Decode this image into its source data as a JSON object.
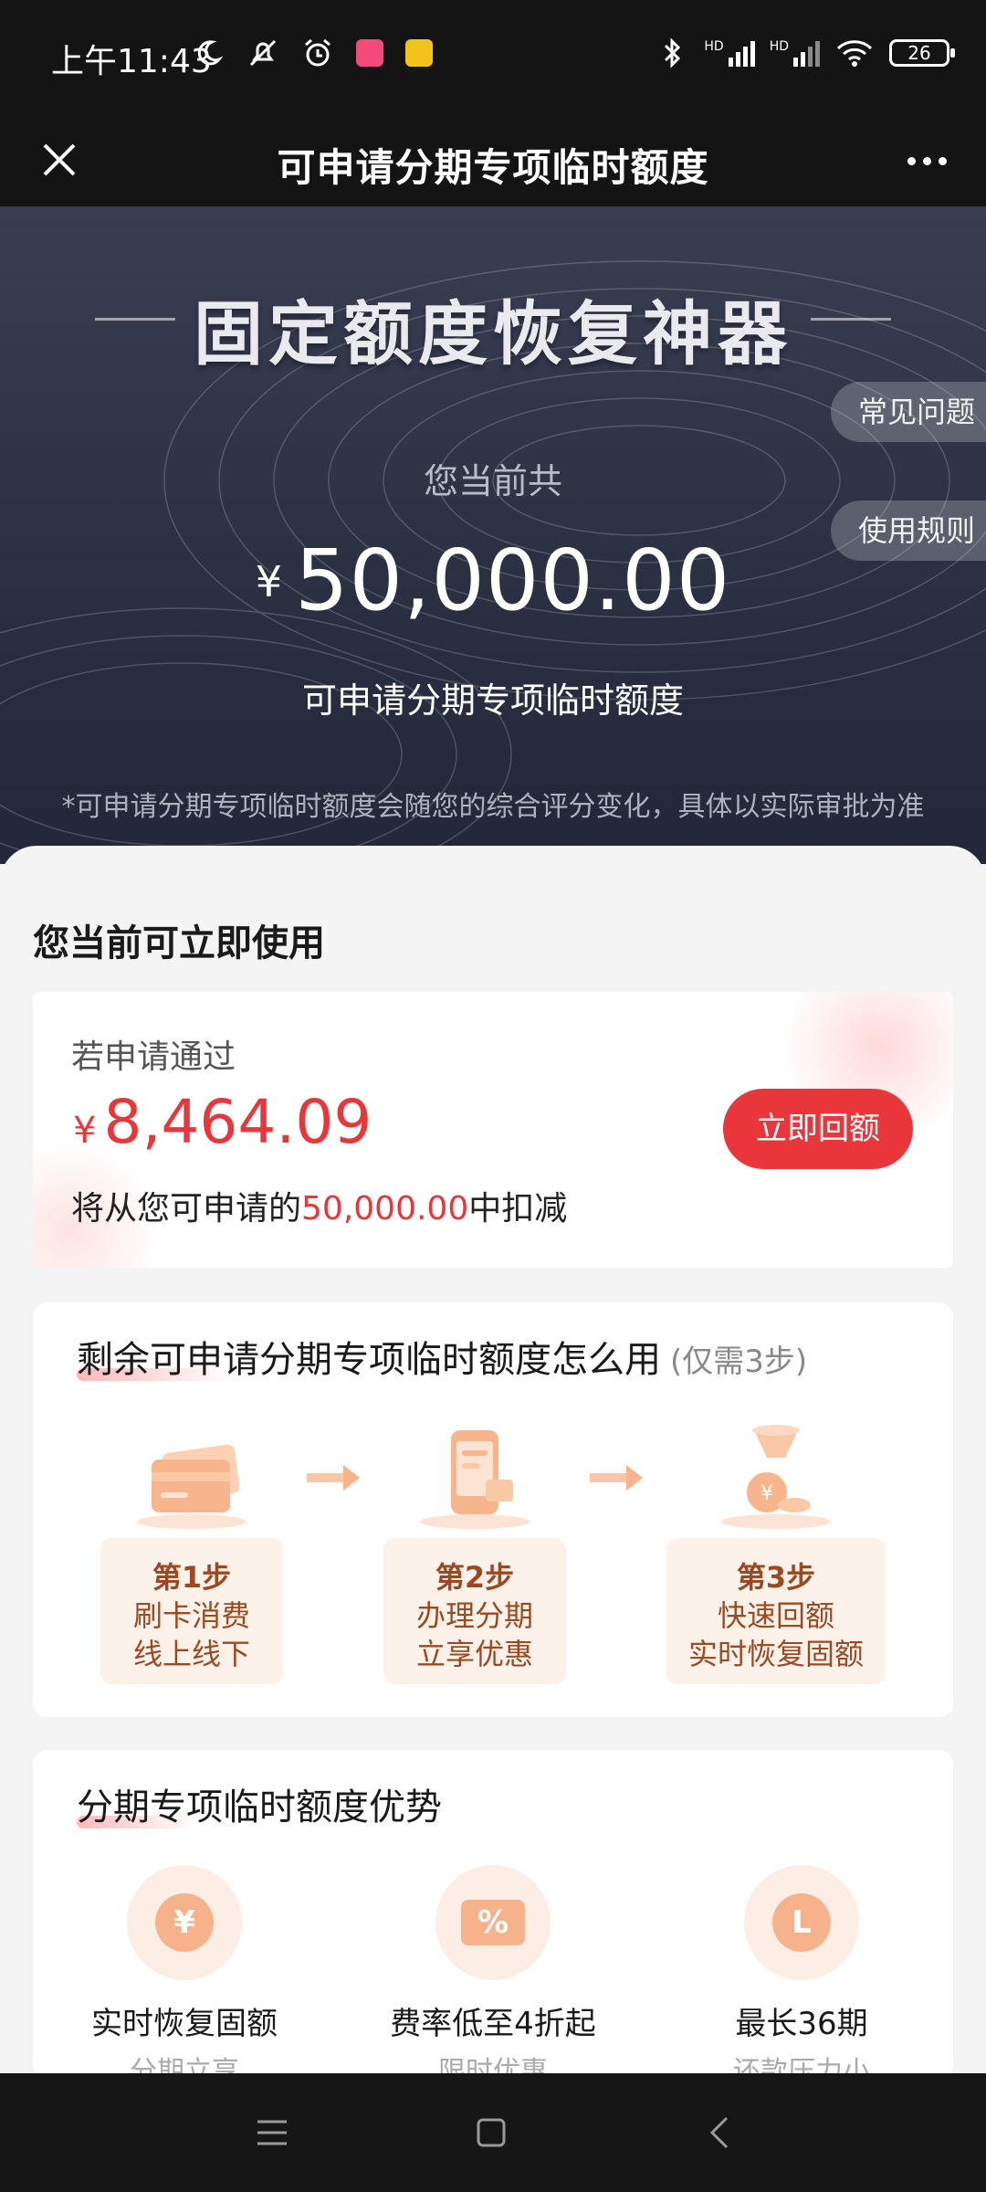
{
  "status_bar": {
    "time": "上午11:43",
    "battery": "26",
    "signal_label_1": "HD",
    "signal_label_2": "HD"
  },
  "title_bar": {
    "title": "可申请分期专项临时额度"
  },
  "hero": {
    "title": "固定额度恢复神器",
    "faq_button": "常见问题",
    "rules_button": "使用规则",
    "subtitle": "您当前共",
    "currency": "¥",
    "amount": "50,000.00",
    "amount_label": "可申请分期专项临时额度",
    "note": "*可申请分期专项临时额度会随您的综合评分变化，具体以实际审批为准"
  },
  "usable": {
    "section_title": "您当前可立即使用",
    "if_approved": "若申请通过",
    "currency": "¥",
    "amount": "8,464.09",
    "desc_prefix": "将从您可申请的",
    "desc_highlight": "50,000.00",
    "desc_suffix": "中扣减",
    "button": "立即回额"
  },
  "how_to": {
    "title": "剩余可申请分期专项临时额度怎么用",
    "title_note": "(仅需3步)",
    "steps": [
      {
        "step": "第1步",
        "line1": "刷卡消费",
        "line2": "线上线下"
      },
      {
        "step": "第2步",
        "line1": "办理分期",
        "line2": "立享优惠"
      },
      {
        "step": "第3步",
        "line1": "快速回额",
        "line2": "实时恢复固额"
      }
    ]
  },
  "advantages": {
    "title": "分期专项临时额度优势",
    "items": [
      {
        "icon": "yen-icon",
        "glyph": "¥",
        "title": "实时恢复固额",
        "sub": "分期立享"
      },
      {
        "icon": "discount-icon",
        "glyph": "%",
        "title": "费率低至4折起",
        "sub": "限时优惠"
      },
      {
        "icon": "clock-icon",
        "glyph": "L",
        "title": "最长36期",
        "sub": "还款压力小"
      }
    ]
  },
  "colors": {
    "accent_red": "#e8363a",
    "hero_bg": "#2c3043",
    "step_text": "#9a4a23"
  }
}
